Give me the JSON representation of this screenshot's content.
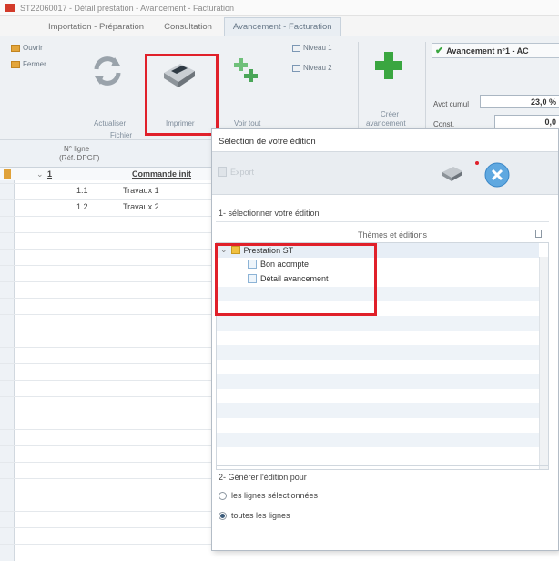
{
  "window": {
    "title": "ST22060017 - Détail prestation - Avancement - Facturation"
  },
  "tabs": [
    {
      "label": "Importation - Préparation",
      "active": false
    },
    {
      "label": "Consultation",
      "active": false
    },
    {
      "label": "Avancement - Facturation",
      "active": true
    }
  ],
  "ribbon": {
    "ouvrir": "Ouvrir",
    "fermer": "Fermer",
    "actualiser": "Actualiser",
    "imprimer": "Imprimer",
    "fichier_group": "Fichier",
    "voir_tout": "Voir tout",
    "niveau1": "Niveau 1",
    "niveau2": "Niveau 2",
    "creer_avancement_1": "Créer",
    "creer_avancement_2": "avancement",
    "avancement_title": "Avancement n°1 - AC",
    "avct_cumul_label": "Avct cumul",
    "avct_cumul_value": "23,0 %",
    "const_label": "Const.",
    "const_value": "0,0"
  },
  "grid": {
    "header_line1": "N° ligne",
    "header_line2": "(Réf. DPGF)",
    "rows": [
      {
        "num": "1",
        "label": "Commande init"
      },
      {
        "num": "1.1",
        "label": "Travaux 1"
      },
      {
        "num": "1.2",
        "label": "Travaux 2"
      }
    ]
  },
  "dialog": {
    "title": "Sélection de votre édition",
    "export_label": "Export",
    "step1": "1- sélectionner votre édition",
    "tree_header": "Thèmes et éditions",
    "tree": {
      "folder": "Prestation ST",
      "items": [
        "Bon acompte",
        "Détail avancement"
      ]
    },
    "step2": "2- Générer l'édition pour :",
    "options": [
      {
        "label": "les lignes sélectionnées",
        "selected": false
      },
      {
        "label": "toutes les lignes",
        "selected": true
      }
    ]
  },
  "colors": {
    "highlight_red": "#e0202a",
    "accent_green": "#3aa640"
  }
}
